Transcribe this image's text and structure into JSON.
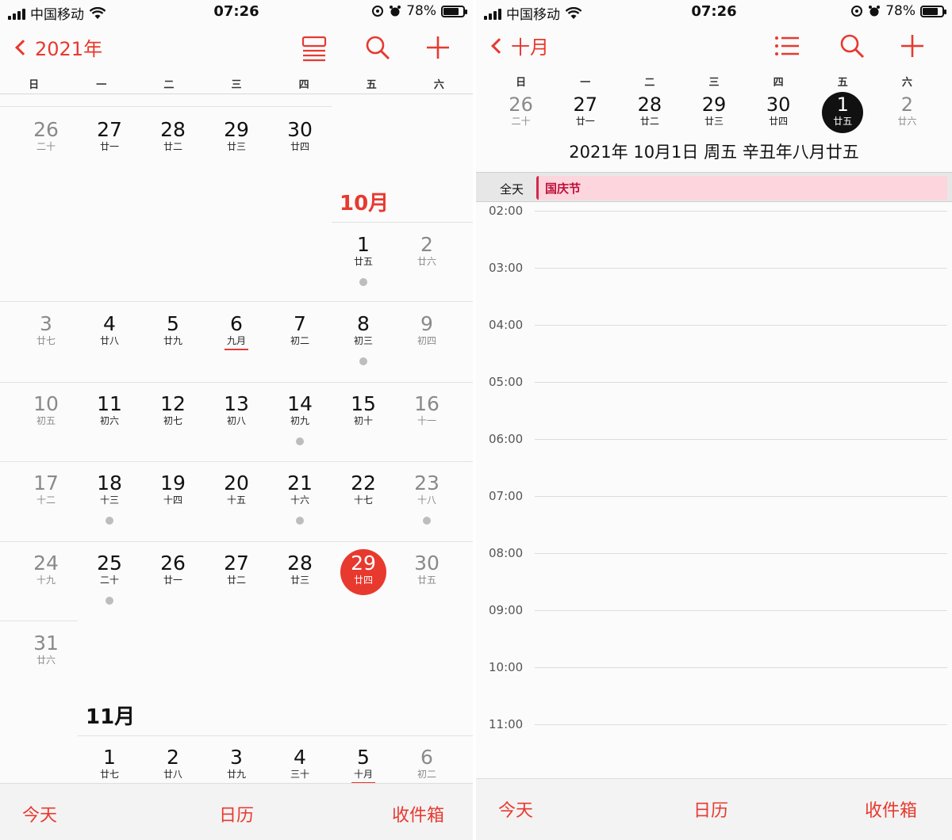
{
  "status": {
    "carrier": "中国移动",
    "time": "07:26",
    "battery": "78%",
    "battery_level": 0.78
  },
  "weekdays": [
    "日",
    "一",
    "二",
    "三",
    "四",
    "五",
    "六"
  ],
  "left": {
    "nav": {
      "back_label": "2021年"
    },
    "month_oct": "10月",
    "month_nov": "11月",
    "sep_row": [
      {
        "d": "26",
        "l": "二十"
      },
      {
        "d": "27",
        "l": "廿一"
      },
      {
        "d": "28",
        "l": "廿二"
      },
      {
        "d": "29",
        "l": "廿三"
      },
      {
        "d": "30",
        "l": "廿四"
      }
    ],
    "oct_week1": [
      {
        "d": "1",
        "l": "廿五",
        "dot": true
      },
      {
        "d": "2",
        "l": "廿六"
      }
    ],
    "oct_week2": [
      {
        "d": "3",
        "l": "廿七"
      },
      {
        "d": "4",
        "l": "廿八"
      },
      {
        "d": "5",
        "l": "廿九"
      },
      {
        "d": "6",
        "l": "九月",
        "ul": true
      },
      {
        "d": "7",
        "l": "初二"
      },
      {
        "d": "8",
        "l": "初三",
        "dot": true
      },
      {
        "d": "9",
        "l": "初四"
      }
    ],
    "oct_week3": [
      {
        "d": "10",
        "l": "初五"
      },
      {
        "d": "11",
        "l": "初六"
      },
      {
        "d": "12",
        "l": "初七"
      },
      {
        "d": "13",
        "l": "初八"
      },
      {
        "d": "14",
        "l": "初九",
        "dot": true
      },
      {
        "d": "15",
        "l": "初十"
      },
      {
        "d": "16",
        "l": "十一"
      }
    ],
    "oct_week4": [
      {
        "d": "17",
        "l": "十二"
      },
      {
        "d": "18",
        "l": "十三",
        "dot": true
      },
      {
        "d": "19",
        "l": "十四"
      },
      {
        "d": "20",
        "l": "十五"
      },
      {
        "d": "21",
        "l": "十六",
        "dot": true
      },
      {
        "d": "22",
        "l": "十七"
      },
      {
        "d": "23",
        "l": "十八",
        "dot": true
      }
    ],
    "oct_week5": [
      {
        "d": "24",
        "l": "十九"
      },
      {
        "d": "25",
        "l": "二十",
        "dot": true
      },
      {
        "d": "26",
        "l": "廿一"
      },
      {
        "d": "27",
        "l": "廿二"
      },
      {
        "d": "28",
        "l": "廿三"
      },
      {
        "d": "29",
        "l": "廿四",
        "today": true
      },
      {
        "d": "30",
        "l": "廿五"
      }
    ],
    "oct_week6": [
      {
        "d": "31",
        "l": "廿六"
      }
    ],
    "nov_week1": [
      {
        "d": "1",
        "l": "廿七"
      },
      {
        "d": "2",
        "l": "廿八"
      },
      {
        "d": "3",
        "l": "廿九"
      },
      {
        "d": "4",
        "l": "三十"
      },
      {
        "d": "5",
        "l": "十月",
        "ul": true
      },
      {
        "d": "6",
        "l": "初二"
      }
    ]
  },
  "right": {
    "nav": {
      "back_label": "十月"
    },
    "week": [
      {
        "d": "26",
        "l": "二十"
      },
      {
        "d": "27",
        "l": "廿一"
      },
      {
        "d": "28",
        "l": "廿二"
      },
      {
        "d": "29",
        "l": "廿三"
      },
      {
        "d": "30",
        "l": "廿四"
      },
      {
        "d": "1",
        "l": "廿五",
        "sel": true
      },
      {
        "d": "2",
        "l": "廿六"
      }
    ],
    "date_title": "2021年 10月1日 周五   辛丑年八月廿五",
    "allday_label": "全天",
    "allday_event": "国庆节",
    "hours": [
      "02:00",
      "03:00",
      "04:00",
      "05:00",
      "06:00",
      "07:00",
      "08:00",
      "09:00",
      "10:00",
      "11:00"
    ]
  },
  "tabbar": {
    "today": "今天",
    "calendars": "日历",
    "inbox": "收件箱"
  },
  "colors": {
    "accent": "#e8392f",
    "event": "#fcd5dd",
    "event_text": "#c0103b"
  }
}
